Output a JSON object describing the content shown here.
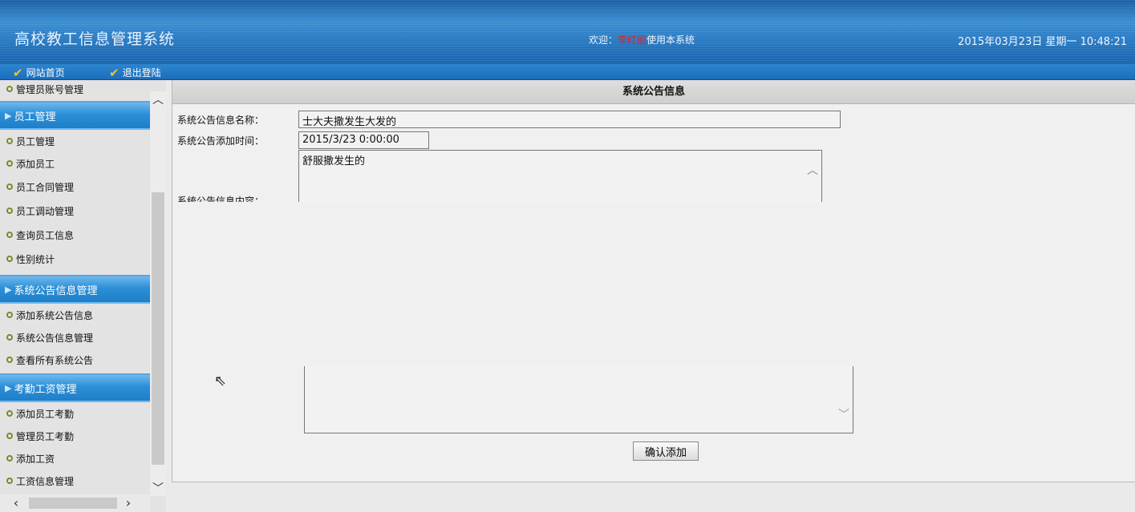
{
  "header": {
    "title": "高校教工信息管理系统",
    "welcome_prefix": "欢迎：",
    "username": "李红丽",
    "welcome_suffix": "使用本系统",
    "datetime": "2015年03月23日 星期一 10:48:21"
  },
  "navbar": {
    "home": "网站首页",
    "logout": "退出登陆"
  },
  "sidebar": {
    "top_item": "管理员账号管理",
    "groups": [
      {
        "title": "员工管理",
        "items": [
          "员工管理",
          "添加员工",
          "员工合同管理",
          "员工调动管理",
          "查询员工信息",
          "性别统计"
        ]
      },
      {
        "title": "系统公告信息管理",
        "items": [
          "添加系统公告信息",
          "系统公告信息管理",
          "查看所有系统公告"
        ]
      },
      {
        "title": "考勤工资管理",
        "items": [
          "添加员工考勤",
          "管理员工考勤",
          "添加工资",
          "工资信息管理"
        ]
      }
    ]
  },
  "main": {
    "panel_title": "系统公告信息",
    "name_label": "系统公告信息名称：",
    "name_value": "士大夫撒发生大发的",
    "time_label": "系统公告添加时间：",
    "time_value": "2015/3/23 0:00:00",
    "content_label": "系统公告信息内容：",
    "content_value": "舒服撒发生的",
    "submit_label": "确认添加"
  },
  "colors": {
    "header_blue": "#2a7cc4",
    "menu_head_blue": "#2c8fd8",
    "username_red": "#d9262b"
  }
}
